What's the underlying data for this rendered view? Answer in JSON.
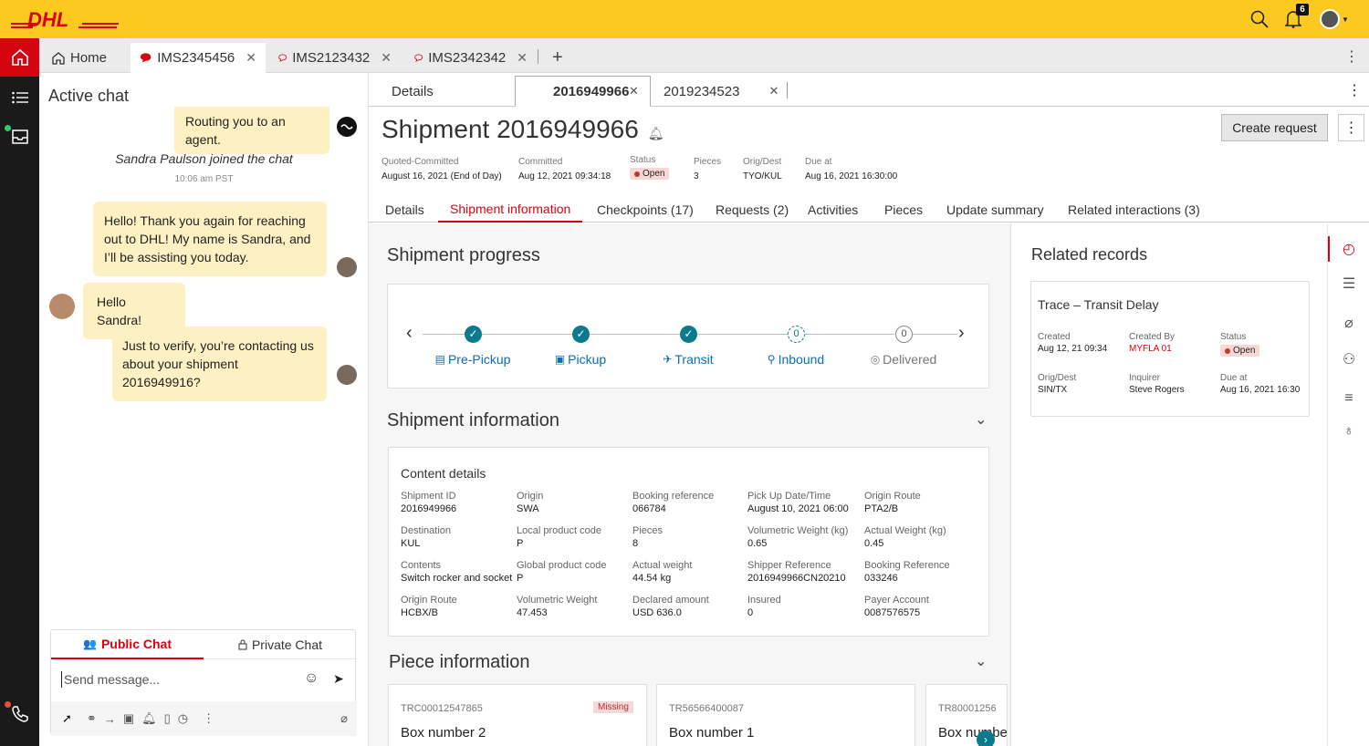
{
  "brand": {
    "logo": "DHL",
    "accent": "#d40511",
    "yellow": "#fcc921"
  },
  "topbar": {
    "notifications_count": "6",
    "icons": [
      "search-icon",
      "bell-icon",
      "avatar-icon"
    ]
  },
  "tabs": [
    {
      "label": "Home",
      "icon": "home-icon"
    },
    {
      "label": "IMS2345456",
      "icon": "chat-filled-icon",
      "active": true
    },
    {
      "label": "IMS2123432",
      "icon": "chat-outline-icon"
    },
    {
      "label": "IMS2342342",
      "icon": "chat-outline-icon"
    }
  ],
  "chat": {
    "title": "Active chat",
    "messages": [
      {
        "text": "Routing you to an agent.",
        "from": "bot"
      },
      {
        "text": "Sandra Paulson joined the chat",
        "type": "system"
      },
      {
        "text": "10:06 am PST",
        "type": "time"
      },
      {
        "text": "Hello! Thank you again for reaching out to DHL! My name is Sandra, and I’ll be assisting you today.",
        "from": "agent"
      },
      {
        "text": "Hello Sandra!",
        "from": "customer"
      },
      {
        "text": "Just to verify, you’re contacting us about your shipment 2016949916?",
        "from": "agent"
      }
    ],
    "public_tab": "Public Chat",
    "private_tab": "Private Chat",
    "placeholder": "Send message..."
  },
  "subtabs": [
    {
      "label": "Details"
    },
    {
      "label": "2016949966",
      "active": true
    },
    {
      "label": "2019234523"
    }
  ],
  "shipment": {
    "title": "Shipment 2016949966",
    "meta": [
      {
        "label": "Quoted-Committed",
        "value": "August 16, 2021 (End of Day)"
      },
      {
        "label": "Committed",
        "value": "Aug 12, 2021 09:34:18"
      },
      {
        "label": "Status",
        "value": "Open"
      },
      {
        "label": "Pieces",
        "value": "3"
      },
      {
        "label": "Orig/Dest",
        "value": "TYO/KUL"
      },
      {
        "label": "Due at",
        "value": "Aug 16, 2021 16:30:00"
      }
    ],
    "create_request": "Create request"
  },
  "navtabs": [
    "Details",
    "Shipment information",
    "Checkpoints (17)",
    "Requests (2)",
    "Activities",
    "Pieces",
    "Update summary",
    "Related interactions (3)"
  ],
  "progress": {
    "title": "Shipment progress",
    "steps": [
      {
        "label": "Pre-Pickup",
        "state": "done"
      },
      {
        "label": "Pickup",
        "state": "done"
      },
      {
        "label": "Transit",
        "state": "done"
      },
      {
        "label": "Inbound",
        "state": "current",
        "num": "0"
      },
      {
        "label": "Delivered",
        "state": "todo",
        "num": "0"
      }
    ]
  },
  "shipment_info": {
    "title": "Shipment information",
    "content_title": "Content details",
    "fields": [
      {
        "label": "Shipment ID",
        "value": "2016949966"
      },
      {
        "label": "Origin",
        "value": "SWA"
      },
      {
        "label": "Booking reference",
        "value": "066784"
      },
      {
        "label": "Pick Up Date/Time",
        "value": "August 10, 2021 06:00"
      },
      {
        "label": "Origin Route",
        "value": "PTA2/B"
      },
      {
        "label": "Destination",
        "value": "KUL"
      },
      {
        "label": "Local product code",
        "value": "P"
      },
      {
        "label": "Pieces",
        "value": "8"
      },
      {
        "label": "Volumetric Weight (kg)",
        "value": "0.65"
      },
      {
        "label": "Actual Weight (kg)",
        "value": "0.45"
      },
      {
        "label": "Contents",
        "value": "Switch rocker and socket"
      },
      {
        "label": "Global product code",
        "value": "P"
      },
      {
        "label": "Actual weight",
        "value": "44.54 kg"
      },
      {
        "label": "Shipper Reference",
        "value": "2016949966CN20210"
      },
      {
        "label": "Booking Reference",
        "value": "033246"
      },
      {
        "label": "Origin Route",
        "value": "HCBX/B"
      },
      {
        "label": "Volumetric Weight",
        "value": "47.453"
      },
      {
        "label": "Declared amount",
        "value": "USD 636.0"
      },
      {
        "label": "Insured",
        "value": "0"
      },
      {
        "label": "Payer Account",
        "value": "0087576575"
      }
    ]
  },
  "pieces": {
    "title": "Piece information",
    "items": [
      {
        "id": "TRC00012547865",
        "name": "Box number 2",
        "badge": "Missing"
      },
      {
        "id": "TR56566400087",
        "name": "Box number 1"
      },
      {
        "id": "TR80001256",
        "name": "Box numbe"
      }
    ]
  },
  "related": {
    "title": "Related records",
    "card_title": "Trace – Transit Delay",
    "fields": [
      {
        "label": "Created",
        "value": "Aug 12, 21 09:34"
      },
      {
        "label": "Created By",
        "value": "MYFLA 01"
      },
      {
        "label": "Status",
        "value": "Open"
      },
      {
        "label": "Orig/Dest",
        "value": "SIN/TX"
      },
      {
        "label": "Inquirer",
        "value": "Steve Rogers"
      },
      {
        "label": "Due at",
        "value": "Aug 16, 2021 16:30"
      }
    ]
  }
}
